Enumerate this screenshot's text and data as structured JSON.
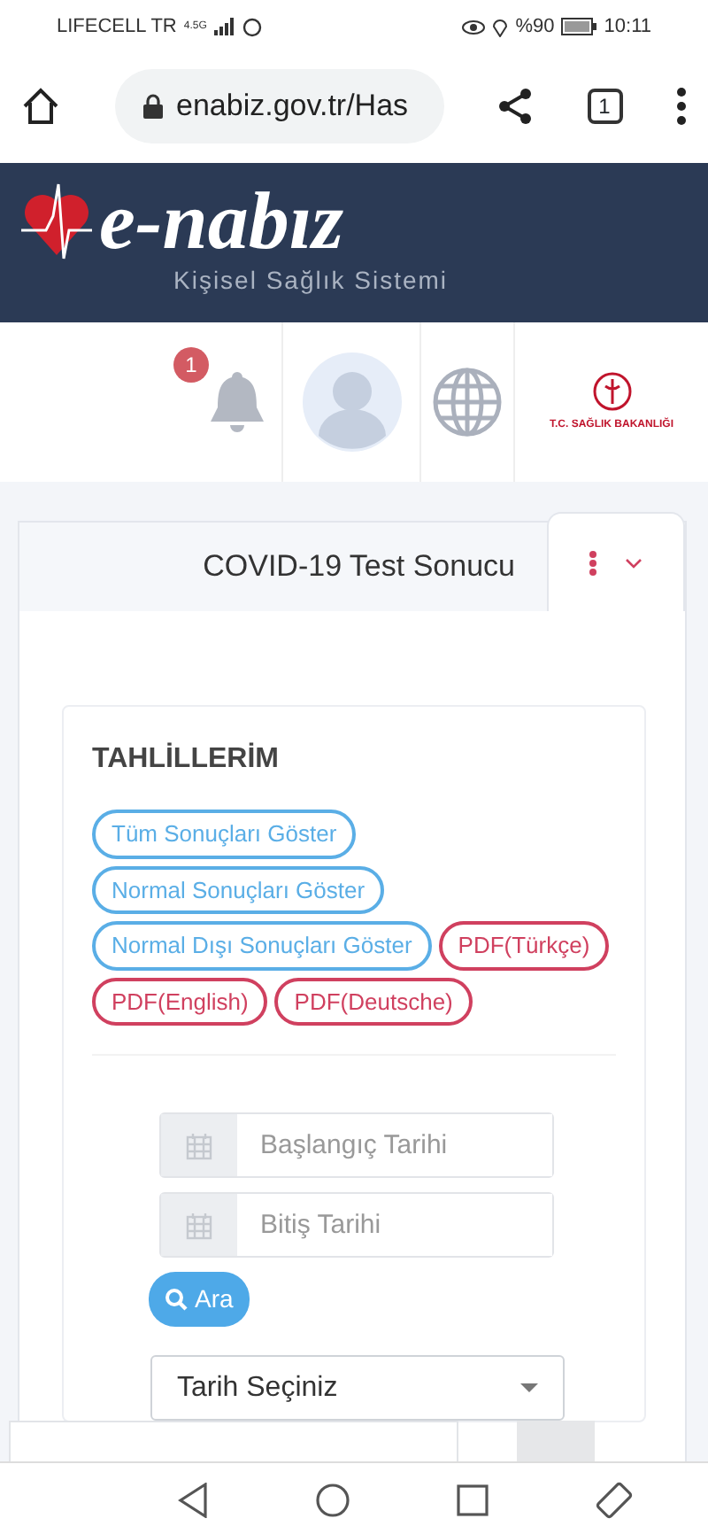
{
  "status_bar": {
    "carrier": "LIFECELL TR",
    "network": "4.5G",
    "battery": "%90",
    "time": "10:11"
  },
  "browser": {
    "url": "enabiz.gov.tr/Has",
    "tab_count": "1"
  },
  "header": {
    "logo": "e-nabız",
    "subtitle": "Kişisel Sağlık Sistemi"
  },
  "toolbar": {
    "notification_count": "1",
    "ministry": "T.C. SAĞLIK BAKANLIĞI"
  },
  "card": {
    "title": "COVID-19 Test Sonucu",
    "panel": {
      "heading": "TAHLİLLERİM",
      "buttons": [
        {
          "label": "Tüm Sonuçları Göster",
          "kind": "filter"
        },
        {
          "label": "Normal Sonuçları Göster",
          "kind": "filter"
        },
        {
          "label": "Normal Dışı Sonuçları Göster",
          "kind": "filter"
        },
        {
          "label": "PDF(Türkçe)",
          "kind": "pdf"
        },
        {
          "label": "PDF(English)",
          "kind": "pdf"
        },
        {
          "label": "PDF(Deutsche)",
          "kind": "pdf"
        }
      ],
      "date_fields": [
        {
          "placeholder": "Başlangıç Tarihi"
        },
        {
          "placeholder": "Bitiş Tarihi"
        }
      ],
      "search_button": "Ara",
      "date_select": "Tarih Seçiniz"
    }
  }
}
